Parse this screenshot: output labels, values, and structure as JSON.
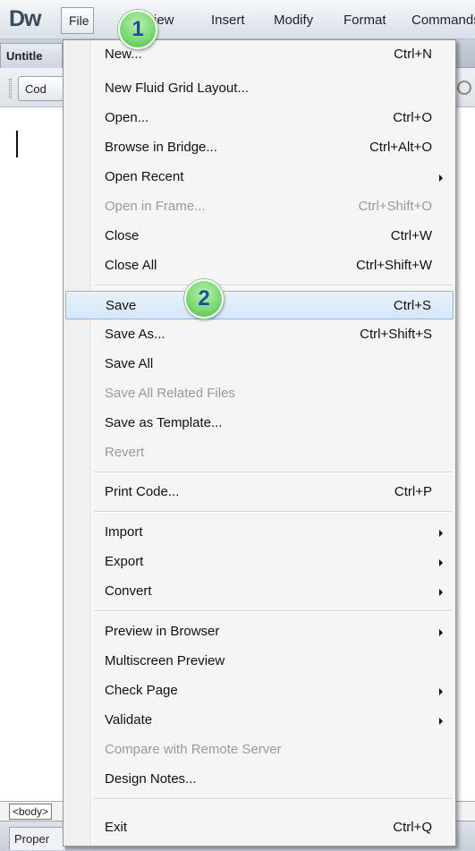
{
  "app": {
    "logo": "Dw",
    "menubar": [
      "File",
      "View",
      "Insert",
      "Modify",
      "Format",
      "Commands"
    ],
    "document_tab": "Untitle",
    "toolbar_code_button": "Cod",
    "tag_selector": "<body>",
    "properties_tab": "Proper"
  },
  "file_menu": {
    "items": [
      {
        "label": "New...",
        "shortcut": "Ctrl+N",
        "enabled": true
      },
      {
        "label": "New Fluid Grid Layout...",
        "shortcut": "",
        "enabled": true
      },
      {
        "label": "Open...",
        "shortcut": "Ctrl+O",
        "enabled": true
      },
      {
        "label": "Browse in Bridge...",
        "shortcut": "Ctrl+Alt+O",
        "enabled": true
      },
      {
        "label": "Open Recent",
        "shortcut": "",
        "enabled": true,
        "submenu": true
      },
      {
        "label": "Open in Frame...",
        "shortcut": "Ctrl+Shift+O",
        "enabled": false
      },
      {
        "label": "Close",
        "shortcut": "Ctrl+W",
        "enabled": true
      },
      {
        "label": "Close All",
        "shortcut": "Ctrl+Shift+W",
        "enabled": true
      },
      {
        "label": "Save",
        "shortcut": "Ctrl+S",
        "enabled": true,
        "selected": true
      },
      {
        "label": "Save As...",
        "shortcut": "Ctrl+Shift+S",
        "enabled": true
      },
      {
        "label": "Save All",
        "shortcut": "",
        "enabled": true
      },
      {
        "label": "Save All Related Files",
        "shortcut": "",
        "enabled": false
      },
      {
        "label": "Save as Template...",
        "shortcut": "",
        "enabled": true
      },
      {
        "label": "Revert",
        "shortcut": "",
        "enabled": false
      },
      {
        "label": "Print Code...",
        "shortcut": "Ctrl+P",
        "enabled": true
      },
      {
        "label": "Import",
        "shortcut": "",
        "enabled": true,
        "submenu": true
      },
      {
        "label": "Export",
        "shortcut": "",
        "enabled": true,
        "submenu": true
      },
      {
        "label": "Convert",
        "shortcut": "",
        "enabled": true,
        "submenu": true
      },
      {
        "label": "Preview in Browser",
        "shortcut": "",
        "enabled": true,
        "submenu": true
      },
      {
        "label": "Multiscreen Preview",
        "shortcut": "",
        "enabled": true
      },
      {
        "label": "Check Page",
        "shortcut": "",
        "enabled": true,
        "submenu": true
      },
      {
        "label": "Validate",
        "shortcut": "",
        "enabled": true,
        "submenu": true
      },
      {
        "label": "Compare with Remote Server",
        "shortcut": "",
        "enabled": false
      },
      {
        "label": "Design Notes...",
        "shortcut": "",
        "enabled": true
      },
      {
        "label": "Exit",
        "shortcut": "Ctrl+Q",
        "enabled": true
      }
    ]
  },
  "step_badges": [
    "1",
    "2"
  ],
  "colors": {
    "selection_fill": "#d6e6f8",
    "selection_border": "#8fb6e0",
    "disabled_text": "#9a9a9a",
    "badge_green": "#7fd877",
    "badge_number": "#1a4fa0"
  }
}
